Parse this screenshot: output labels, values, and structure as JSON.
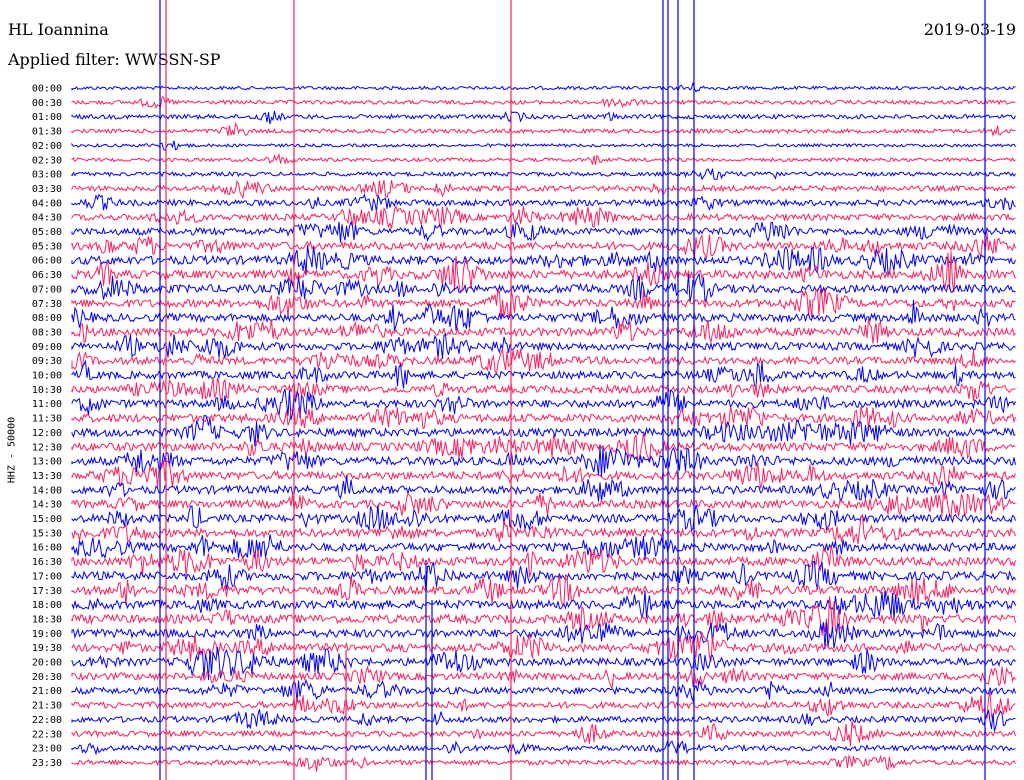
{
  "header": {
    "station": "HL Ioannina",
    "date": "2019-03-19",
    "filter": "Applied filter: WWSSN-SP"
  },
  "channel_label": "HHZ - 50000",
  "colors": {
    "trace_a": "#0000ff",
    "trace_b": "#ff1f5a"
  },
  "chart_data": {
    "type": "line",
    "title": "HL Ioannina",
    "subtitle": "Applied filter: WWSSN-SP",
    "ylabel": "HHZ - 50000",
    "categories": [
      "00:00",
      "00:30",
      "01:00",
      "01:30",
      "02:00",
      "02:30",
      "03:00",
      "03:30",
      "04:00",
      "04:30",
      "05:00",
      "05:30",
      "06:00",
      "06:30",
      "07:00",
      "07:30",
      "08:00",
      "08:30",
      "09:00",
      "09:30",
      "10:00",
      "10:30",
      "11:00",
      "11:30",
      "12:00",
      "12:30",
      "13:00",
      "13:30",
      "14:00",
      "14:30",
      "15:00",
      "15:30",
      "16:00",
      "16:30",
      "17:00",
      "17:30",
      "18:00",
      "18:30",
      "19:00",
      "19:30",
      "20:00",
      "20:30",
      "21:00",
      "21:30",
      "22:00",
      "22:30",
      "23:00",
      "23:30"
    ],
    "tick_labels": [
      "00:00",
      "00:30",
      "01:00",
      "01:30",
      "02:00",
      "02:30",
      "03:00",
      "03:30",
      "04:00",
      "04:30",
      "05:00",
      "05:30",
      "06:00",
      "06:30",
      "07:00",
      "07:30",
      "08:00",
      "08:30",
      "09:00",
      "09:30",
      "10:00",
      "10:30",
      "11:00",
      "11:30",
      "12:00",
      "12:30",
      "13:00",
      "13:30",
      "14:00",
      "14:30",
      "15:00",
      "15:30",
      "16:00",
      "16:30",
      "17:00",
      "17:30",
      "18:00",
      "18:30",
      "19:00",
      "19:30",
      "20:00",
      "20:30",
      "21:00",
      "21:30",
      "22:00",
      "22:30",
      "23:00",
      "23:30"
    ],
    "series_colors": [
      "#0000ff",
      "#ff1f5a"
    ],
    "noise_level": [
      0.15,
      0.25,
      0.3,
      0.25,
      0.1,
      0.2,
      0.25,
      0.45,
      0.55,
      0.6,
      0.7,
      0.85,
      0.95,
      0.95,
      0.9,
      0.85,
      0.85,
      0.9,
      0.8,
      0.8,
      0.8,
      0.8,
      0.85,
      0.9,
      0.9,
      0.9,
      0.9,
      0.85,
      0.85,
      0.85,
      0.85,
      0.9,
      0.9,
      0.95,
      0.95,
      0.95,
      0.95,
      0.95,
      0.9,
      0.9,
      0.8,
      0.7,
      0.65,
      0.6,
      0.55,
      0.5,
      0.45,
      0.4
    ]
  }
}
